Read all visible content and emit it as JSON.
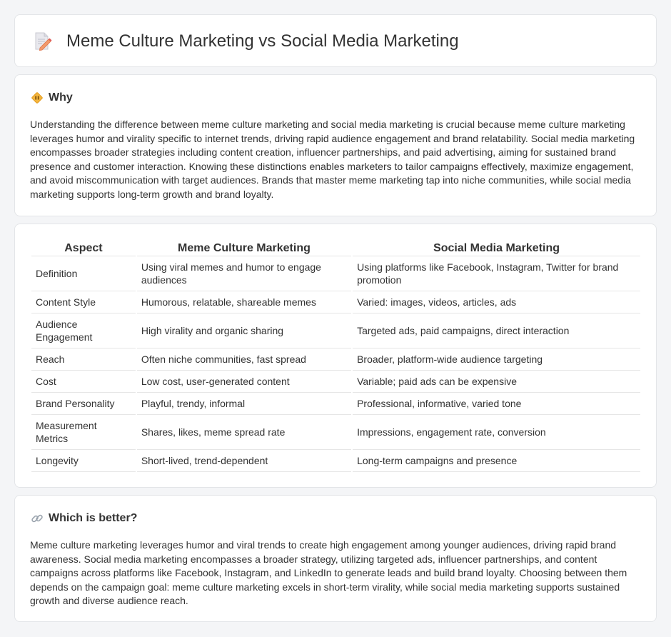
{
  "header": {
    "title": "Meme Culture Marketing vs Social Media Marketing",
    "icon": "document-pencil-icon"
  },
  "why": {
    "title": "Why",
    "icon": "diamond-sign-icon",
    "text": "Understanding the difference between meme culture marketing and social media marketing is crucial because meme culture marketing leverages humor and virality specific to internet trends, driving rapid audience engagement and brand relatability. Social media marketing encompasses broader strategies including content creation, influencer partnerships, and paid advertising, aiming for sustained brand presence and customer interaction. Knowing these distinctions enables marketers to tailor campaigns effectively, maximize engagement, and avoid miscommunication with target audiences. Brands that master meme marketing tap into niche communities, while social media marketing supports long-term growth and brand loyalty."
  },
  "comparison": {
    "headers": [
      "Aspect",
      "Meme Culture Marketing",
      "Social Media Marketing"
    ],
    "rows": [
      [
        "Definition",
        "Using viral memes and humor to engage audiences",
        "Using platforms like Facebook, Instagram, Twitter for brand promotion"
      ],
      [
        "Content Style",
        "Humorous, relatable, shareable memes",
        "Varied: images, videos, articles, ads"
      ],
      [
        "Audience Engagement",
        "High virality and organic sharing",
        "Targeted ads, paid campaigns, direct interaction"
      ],
      [
        "Reach",
        "Often niche communities, fast spread",
        "Broader, platform-wide audience targeting"
      ],
      [
        "Cost",
        "Low cost, user-generated content",
        "Variable; paid ads can be expensive"
      ],
      [
        "Brand Personality",
        "Playful, trendy, informal",
        "Professional, informative, varied tone"
      ],
      [
        "Measurement Metrics",
        "Shares, likes, meme spread rate",
        "Impressions, engagement rate, conversion"
      ],
      [
        "Longevity",
        "Short-lived, trend-dependent",
        "Long-term campaigns and presence"
      ]
    ]
  },
  "better": {
    "title": "Which is better?",
    "icon": "link-icon",
    "text": "Meme culture marketing leverages humor and viral trends to create high engagement among younger audiences, driving rapid brand awareness. Social media marketing encompasses a broader strategy, utilizing targeted ads, influencer partnerships, and content campaigns across platforms like Facebook, Instagram, and LinkedIn to generate leads and build brand loyalty. Choosing between them depends on the campaign goal: meme culture marketing excels in short-term virality, while social media marketing supports sustained growth and diverse audience reach."
  }
}
